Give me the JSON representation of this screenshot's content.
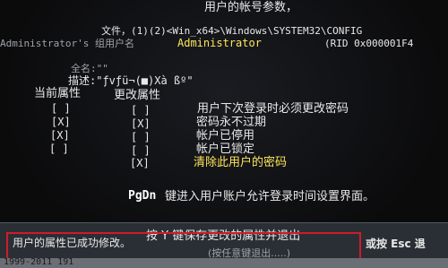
{
  "header": {
    "account_params": "用户的帐号参数，",
    "path_prefix": "文件，(1)(2)<Win_x64>\\Windows\\SYSTEM32\\CONFIG",
    "admin_line": "Administrator's 组用户名",
    "admin_name": "Administrator",
    "rid": "(RID 0x000001F4"
  },
  "user": {
    "fullname_label": "全名:\"\"",
    "desc_label": "描述:\"ƒvƒü¬(■)Xà ßº\""
  },
  "columns": {
    "current": "当前属性",
    "change": "更改属性"
  },
  "rows": [
    {
      "current": "[ ]",
      "change": "[ ]",
      "label": "用户下次登录时必须更改密码"
    },
    {
      "current": "[X]",
      "change": "[X]",
      "label": "密码永不过期"
    },
    {
      "current": "[X]",
      "change": "[ ]",
      "label": "帐户已停用"
    },
    {
      "current": "[ ]",
      "change": "[ ]",
      "label": "帐户已锁定"
    },
    {
      "current": "",
      "change": "[X]",
      "label": "清除此用户的密码"
    }
  ],
  "pgdn_key": "PgDn",
  "pgdn_text": "键进入用户账户允许登录时间设置界面。",
  "bottom": {
    "save_hint": "按 Y 键保存更改的属性并退出",
    "esc_hint": "或按 Esc 退",
    "success": "用户的属性已成功修改。",
    "press_any": "(按任意键退出.....)"
  },
  "footer": "1999-2011 191"
}
